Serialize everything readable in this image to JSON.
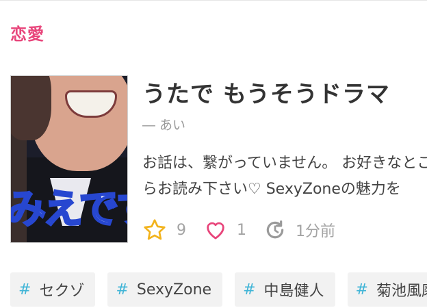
{
  "category": "恋愛",
  "story": {
    "title": "うたで もうそうドラマ",
    "author": "― あい",
    "description_lines": [
      "お話は、繋がっていません。 お好きなところか",
      "らお読み下さい♡ SexyZoneの魅力を"
    ],
    "thumbnail_caption": "みえです",
    "stars": "9",
    "likes": "1",
    "updated": "1分前"
  },
  "icons": {
    "star": "star-icon",
    "heart": "heart-icon",
    "refresh": "refresh-icon"
  },
  "colors": {
    "accent": "#e8457b",
    "star": "#f2b31d",
    "heart": "#e8457b",
    "hash": "#3fb4d6"
  },
  "tags": [
    {
      "hash": "#",
      "label": "セクゾ"
    },
    {
      "hash": "#",
      "label": "SexyZone"
    },
    {
      "hash": "#",
      "label": "中島健人"
    },
    {
      "hash": "#",
      "label": "菊池風磨"
    }
  ]
}
